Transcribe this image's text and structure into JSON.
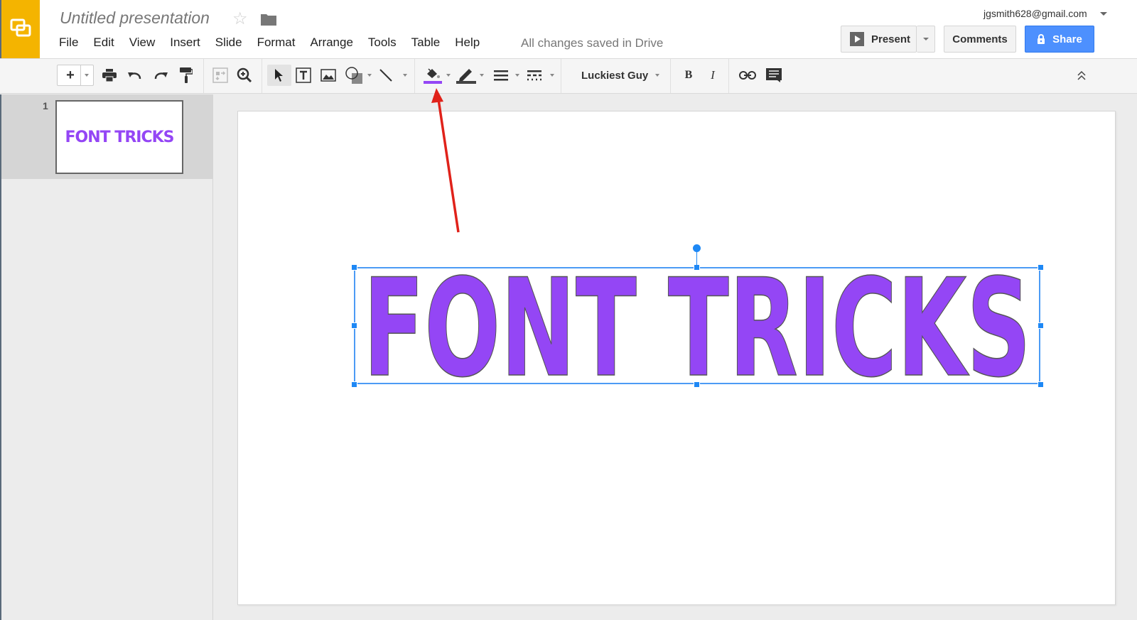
{
  "header": {
    "title": "Untitled presentation",
    "menu": [
      "File",
      "Edit",
      "View",
      "Insert",
      "Slide",
      "Format",
      "Arrange",
      "Tools",
      "Table",
      "Help"
    ],
    "save_status": "All changes saved in Drive",
    "account": "jgsmith628@gmail.com",
    "present_label": "Present",
    "comments_label": "Comments",
    "share_label": "Share"
  },
  "toolbar": {
    "font_name": "Luckiest Guy",
    "fill_color": "#9446f5",
    "tools": [
      "new-slide",
      "print",
      "undo",
      "redo",
      "paint-format",
      "select-fit",
      "zoom",
      "select",
      "text-box",
      "image",
      "shape",
      "line",
      "fill-color",
      "border-color",
      "border-weight",
      "border-dash",
      "font",
      "bold",
      "italic",
      "link",
      "comment",
      "collapse"
    ]
  },
  "filmstrip": {
    "slides": [
      {
        "number": "1",
        "thumbnail_text": "FONT TRICKS"
      }
    ]
  },
  "slide": {
    "text": "FONT TRICKS",
    "text_color": "#9446f5",
    "selection_color": "#1e88f5"
  },
  "annotation": {
    "type": "red-arrow",
    "points_to": "fill-color-button",
    "color": "#e0221a"
  }
}
